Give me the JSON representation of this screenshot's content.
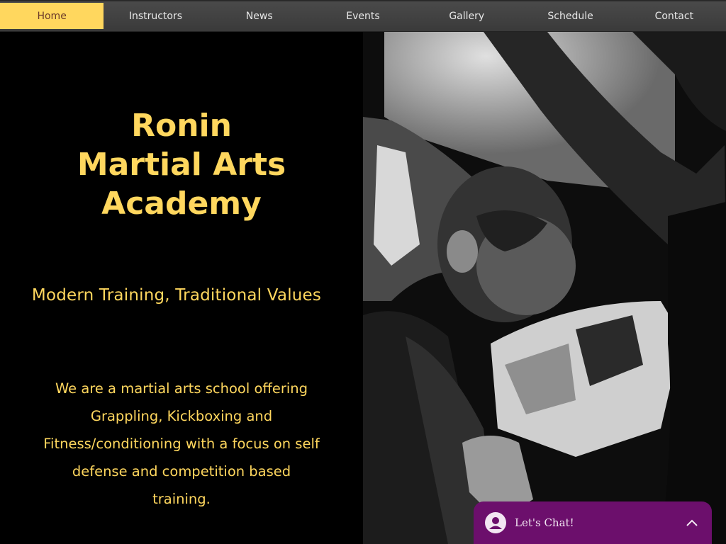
{
  "nav": {
    "items": [
      {
        "label": "Home",
        "active": true
      },
      {
        "label": "Instructors"
      },
      {
        "label": "News"
      },
      {
        "label": "Events"
      },
      {
        "label": "Gallery"
      },
      {
        "label": "Schedule"
      },
      {
        "label": "Contact"
      }
    ]
  },
  "hero": {
    "title_line1": "Ronin",
    "title_line2": "Martial Arts",
    "title_line3": "Academy",
    "tagline": "Modern Training, Traditional Values",
    "description": "We are a martial arts school offering Grappling, Kickboxing and Fitness/conditioning with a focus on self defense and competition based training."
  },
  "chat": {
    "label": "Let's Chat!",
    "avatar_icon": "user-avatar-icon",
    "toggle_icon": "chevron-up-icon"
  },
  "colors": {
    "accent": "#ffd75e",
    "nav_bg": "#404040",
    "chat_bg": "#6c0f6c",
    "background": "#000000"
  }
}
